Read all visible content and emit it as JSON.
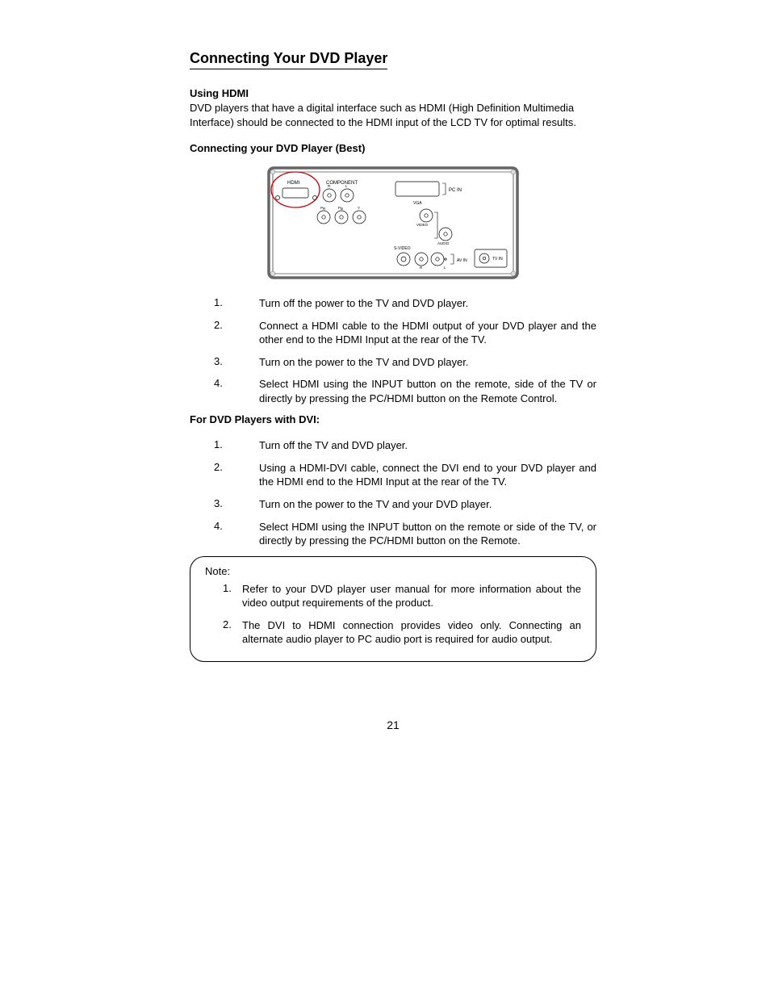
{
  "title": "Connecting Your DVD Player",
  "section1": {
    "heading": "Using HDMI",
    "body": "DVD players that have a digital interface such as HDMI (High Definition Multimedia Interface) should be connected to the HDMI input of the LCD TV for optimal results."
  },
  "section2": {
    "heading": "Connecting your DVD Player (Best)",
    "steps": [
      "Turn off the power to the TV and DVD player.",
      "Connect a HDMI cable to the HDMI output of your DVD player and the other end to the HDMI Input at the rear of the TV.",
      "Turn on the power to the TV and DVD player.",
      "Select HDMI using the INPUT button on the remote, side of the TV or directly by pressing the PC/HDMI button on the Remote Control."
    ]
  },
  "section3": {
    "heading": "For DVD Players with DVI:",
    "steps": [
      "Turn off the TV and DVD player.",
      "Using a HDMI-DVI cable, connect the DVI end to your DVD player and the HDMI end to the HDMI Input at the rear of the TV.",
      "Turn on the power to the TV and your DVD player.",
      "Select HDMI using the INPUT button on the remote or side of the TV, or directly by pressing the PC/HDMI button on the Remote."
    ]
  },
  "note": {
    "label": "Note:",
    "items": [
      "Refer to your DVD player user manual for more information about the video output requirements of the product.",
      "The DVI to HDMI connection provides video only.  Connecting an alternate audio player to PC audio port is required for audio output."
    ]
  },
  "diagram": {
    "hdmi": "HDMI",
    "component": "COMPONENT",
    "r": "R",
    "lc": "L",
    "pr": "P",
    "pb": "P",
    "y": "Y",
    "pr_sub": "R",
    "pb_sub": "B",
    "pcin": "PC IN",
    "vga": "VGA",
    "video": "VIDEO",
    "audio": "AUDIO",
    "svideo": "S-VIDEO",
    "avin": "AV IN",
    "tvin": "TV IN",
    "rl_r": "R",
    "rl_center": "",
    "rl_l": "L"
  },
  "page_number": "21"
}
